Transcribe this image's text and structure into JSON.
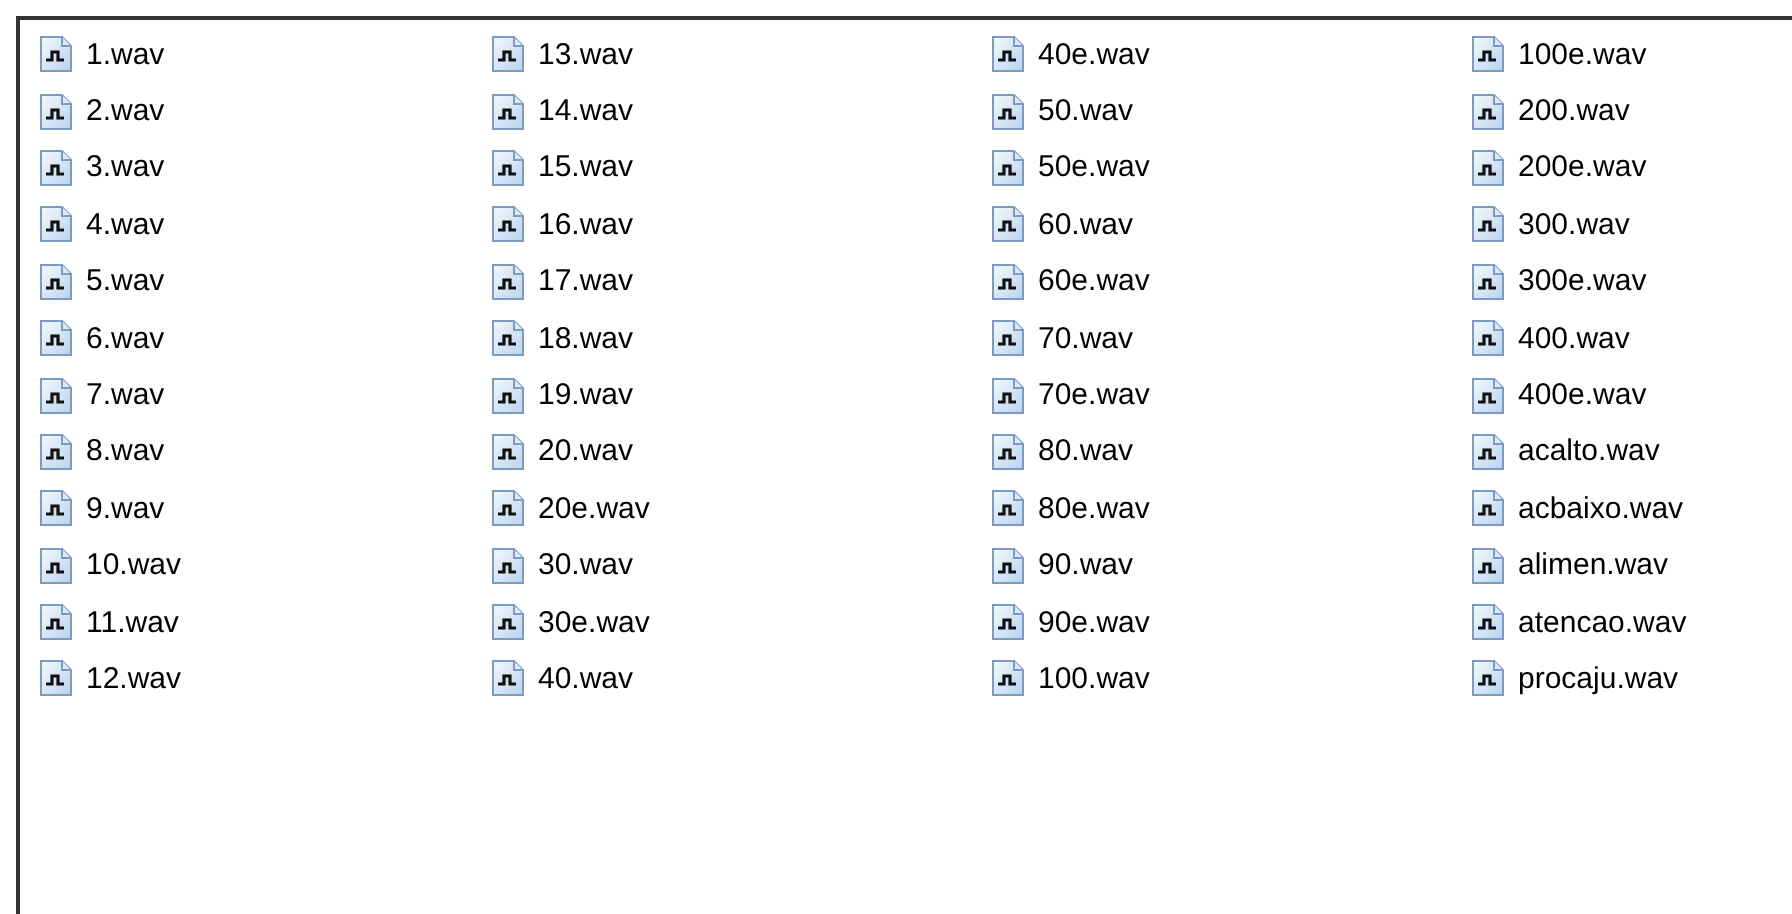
{
  "files": [
    "1.wav",
    "2.wav",
    "3.wav",
    "4.wav",
    "5.wav",
    "6.wav",
    "7.wav",
    "8.wav",
    "9.wav",
    "10.wav",
    "11.wav",
    "12.wav",
    "13.wav",
    "14.wav",
    "15.wav",
    "16.wav",
    "17.wav",
    "18.wav",
    "19.wav",
    "20.wav",
    "20e.wav",
    "30.wav",
    "30e.wav",
    "40.wav",
    "40e.wav",
    "50.wav",
    "50e.wav",
    "60.wav",
    "60e.wav",
    "70.wav",
    "70e.wav",
    "80.wav",
    "80e.wav",
    "90.wav",
    "90e.wav",
    "100.wav",
    "100e.wav",
    "200.wav",
    "200e.wav",
    "300.wav",
    "300e.wav",
    "400.wav",
    "400e.wav",
    "acalto.wav",
    "acbaixo.wav",
    "alimen.wav",
    "atencao.wav",
    "procaju.wav"
  ]
}
